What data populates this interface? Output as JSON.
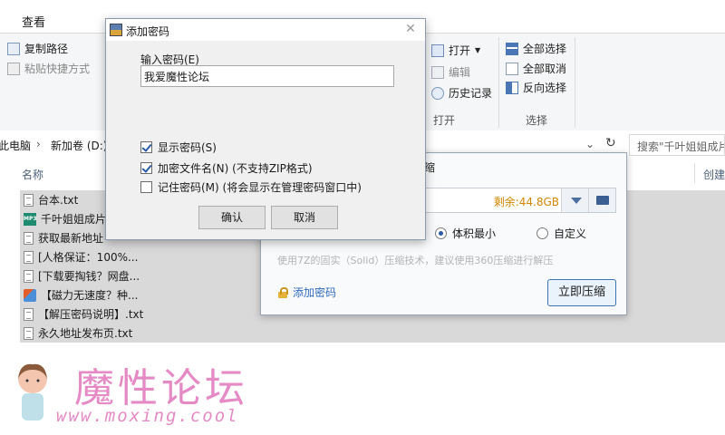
{
  "ribbon": {
    "tab_view": "查看",
    "copy_path": "复制路径",
    "paste_shortcut": "粘贴快捷方式",
    "open": "打开",
    "edit": "编辑",
    "history": "历史记录",
    "open_group": "打开",
    "select_all": "全部选择",
    "select_none": "全部取消",
    "invert": "反向选择",
    "select_group": "选择"
  },
  "address": {
    "crumb1": "此电脑",
    "crumb2": "新加卷 (D:)",
    "search_placeholder": "搜索\"千叶姐姐成片"
  },
  "filelist": {
    "col_name": "名称",
    "col_created": "创建",
    "files": [
      {
        "name": "台本.txt",
        "icon": "txt-file-icon"
      },
      {
        "name": "千叶姐姐成片",
        "icon": "mp3-file-icon"
      },
      {
        "name": "获取最新地址",
        "icon": "txt-file-icon"
      },
      {
        "name": "[人格保证：100%...",
        "icon": "txt-file-icon"
      },
      {
        "name": "[下载要掏钱？网盘...",
        "icon": "txt-file-icon"
      },
      {
        "name": "【磁力无速度？种...",
        "icon": "image-file-icon"
      },
      {
        "name": "【解压密码说明】.txt",
        "icon": "txt-file-icon"
      },
      {
        "name": "永久地址发布页.txt",
        "icon": "txt-file-icon"
      }
    ]
  },
  "compress": {
    "title_fragment": "缩",
    "free_space": "剩余:44.8GB",
    "radio_smallest": "体积最小",
    "radio_custom": "自定义",
    "tip": "使用7Z的固实（Solid）压缩技术，建议使用360压缩进行解压",
    "add_password": "添加密码",
    "compress_now": "立即压缩"
  },
  "pwd_dialog": {
    "title": "添加密码",
    "label": "输入密码(E)",
    "value": "我爱魔性论坛",
    "show_password": "显示密码(S)",
    "encrypt_names": "加密文件名(N) (不支持ZIP格式)",
    "remember": "记住密码(M) (将会显示在管理密码窗口中)",
    "ok": "确认",
    "cancel": "取消"
  },
  "watermark": {
    "title": "魔性论坛",
    "url": "www.moxing.cool"
  },
  "colors": {
    "accent": "#2a5aa8",
    "free_space": "#d38700",
    "watermark": "#e58ac5"
  }
}
